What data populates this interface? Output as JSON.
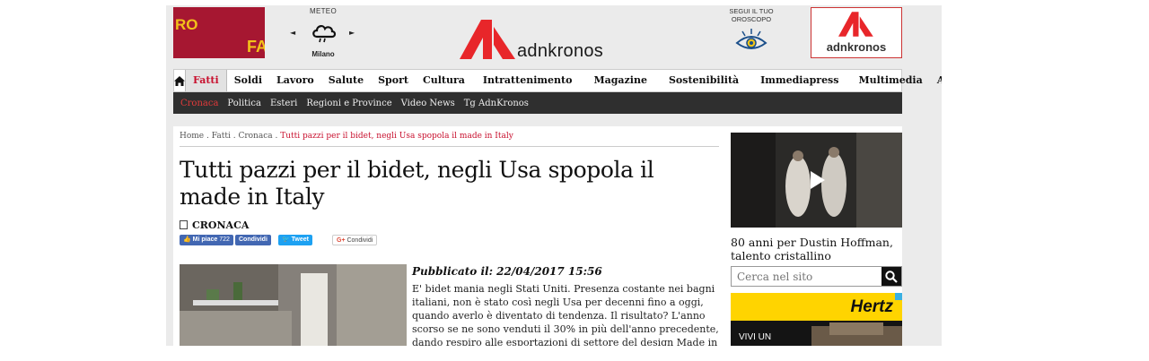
{
  "header": {
    "ad_left": {
      "text_top": "RO",
      "text_bottom": "FA"
    },
    "meteo": {
      "label": "METEO",
      "city": "Milano",
      "prev_arrow": "◄",
      "next_arrow": "►"
    },
    "logo": {
      "text": "adnkronos"
    },
    "oroscopo": {
      "line1": "SEGUI IL TUO",
      "line2": "OROSCOPO"
    },
    "ad_right": {
      "text": "adnkronos"
    }
  },
  "main_nav": {
    "items": [
      {
        "label": "Fatti",
        "active": true
      },
      {
        "label": "Soldi"
      },
      {
        "label": "Lavoro"
      },
      {
        "label": "Salute"
      },
      {
        "label": "Sport"
      },
      {
        "label": "Cultura"
      },
      {
        "label": "Intrattenimento"
      },
      {
        "label": "Magazine"
      },
      {
        "label": "Sostenibilità"
      },
      {
        "label": "Immediapress"
      },
      {
        "label": "Multimedia"
      },
      {
        "label": "AKI"
      }
    ]
  },
  "sub_nav": {
    "items": [
      {
        "label": "Cronaca",
        "active": true
      },
      {
        "label": "Politica"
      },
      {
        "label": "Esteri"
      },
      {
        "label": "Regioni e Province"
      },
      {
        "label": "Video News"
      },
      {
        "label": "Tg AdnKronos"
      }
    ]
  },
  "breadcrumb": {
    "home": "Home",
    "sep": " . ",
    "fatti": "Fatti",
    "cronaca": "Cronaca",
    "current": "Tutti pazzi per il bidet, negli Usa spopola il made in Italy"
  },
  "article": {
    "title": "Tutti pazzi per il bidet, negli Usa spopola il made in Italy",
    "section": "CRONACA",
    "social": {
      "like": "Mi piace",
      "like_count": "722",
      "share_fb": "Condividi",
      "tweet": "Tweet",
      "gplus": "Condividi"
    },
    "published": "Pubblicato il: 22/04/2017 15:56",
    "body": "E' bidet mania negli Stati Uniti. Presenza costante nei bagni italiani, non è stato così negli Usa per decenni fino a oggi, quando averlo è diventato di tendenza. Il risultato? L'anno scorso se ne sono venduti il 30% in più dell'anno precedente, dando respiro alle esportazioni di settore del design Made in Italy. \"C'è un incremento delle vendite dei"
  },
  "sidebar": {
    "video_caption": "80 anni per Dustin Hoffman, talento cristallino",
    "search_placeholder": "Cerca nel sito",
    "ad": {
      "brand": "Hertz",
      "tagline": "VIVI UN"
    }
  },
  "colors": {
    "accent": "#c8102e",
    "subnav_bg": "#2f2f2f",
    "page_bg": "#ebebeb"
  }
}
